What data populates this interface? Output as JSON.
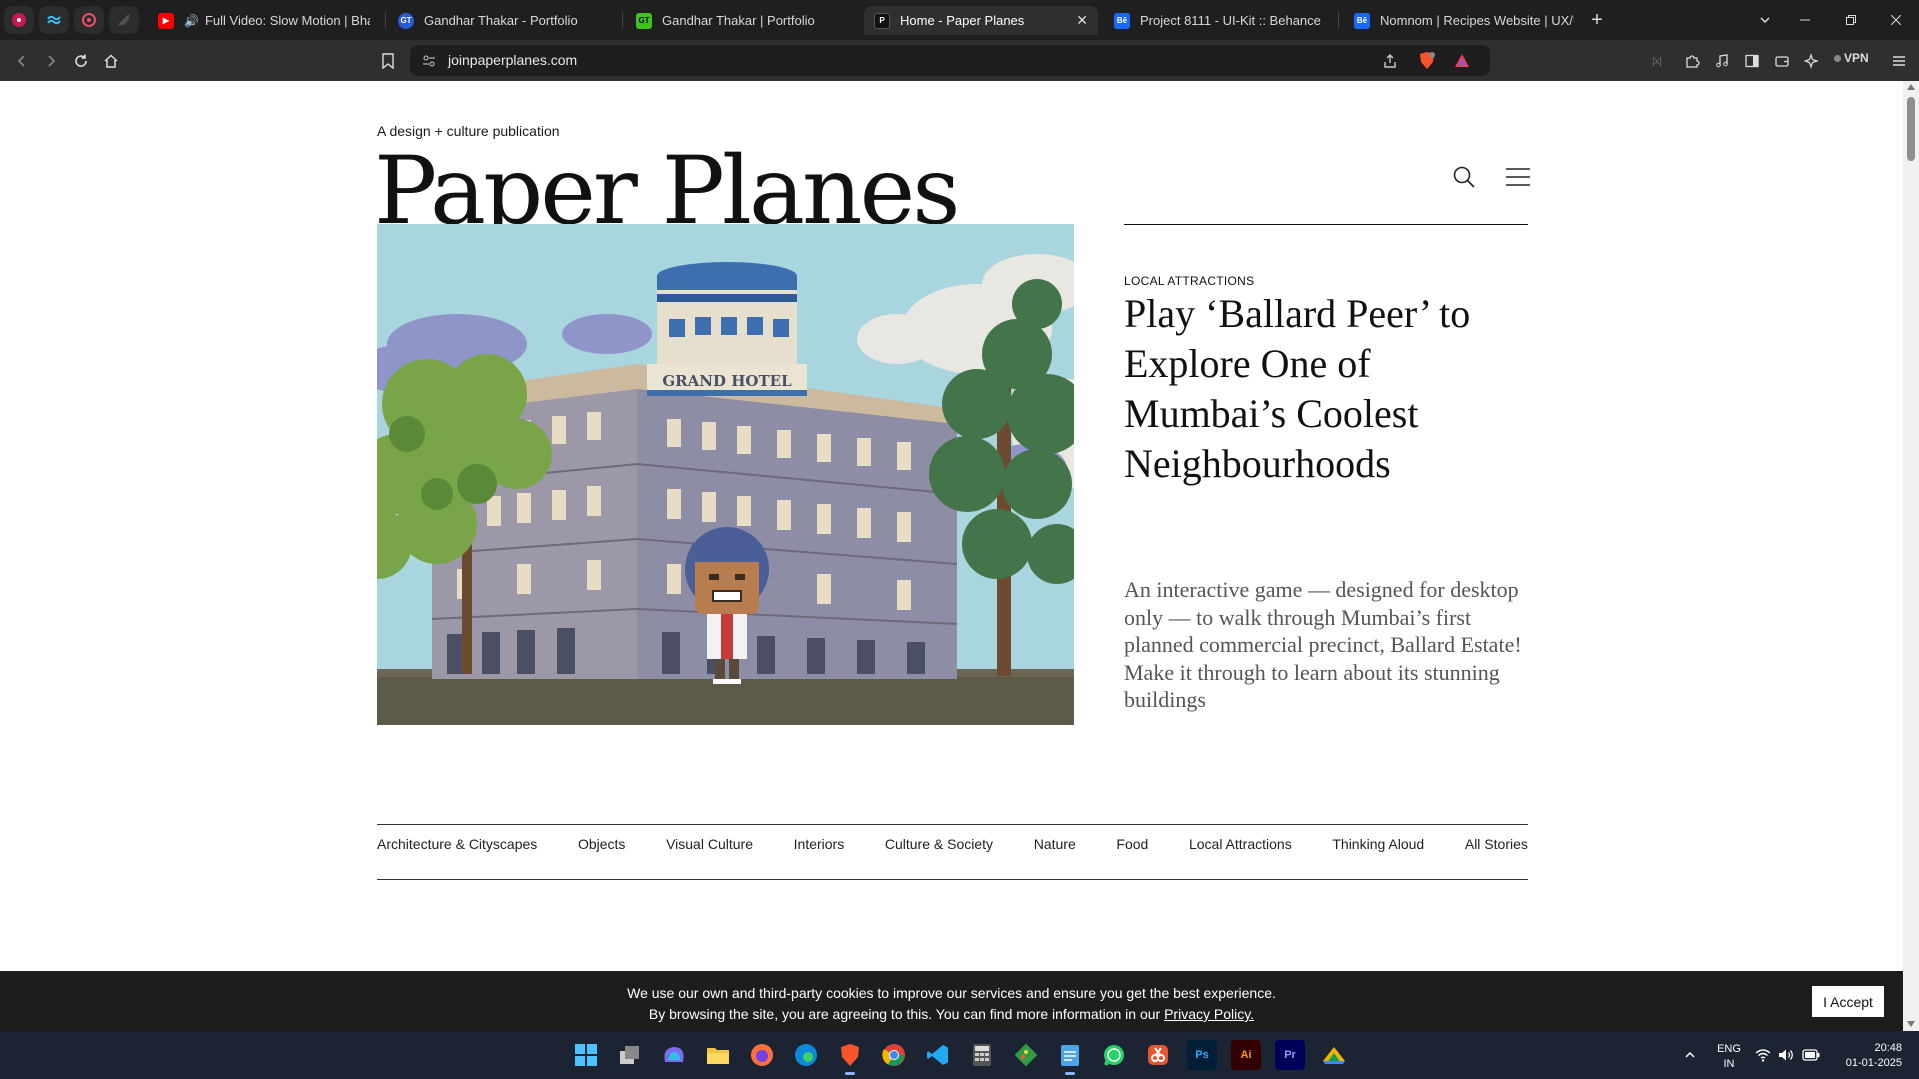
{
  "browser": {
    "tabs": [
      {
        "title": "Full Video: Slow Motion | Bharat",
        "active": false,
        "audio": true
      },
      {
        "title": "Gandhar Thakar - Portfolio",
        "active": false
      },
      {
        "title": "Gandhar Thakar | Portfolio",
        "active": false
      },
      {
        "title": "Home - Paper Planes",
        "active": true
      },
      {
        "title": "Project 8111 - UI-Kit :: Behance",
        "active": false
      },
      {
        "title": "Nomnom | Recipes Website | UX/UI",
        "active": false
      }
    ],
    "favicons": {
      "gt": "GT",
      "paper": "P",
      "behance": "Bē"
    },
    "url": "joinpaperplanes.com",
    "vpn_label": "VPN",
    "colors": {
      "tabstrip": "#1f1f1f",
      "toolbar": "#2f2f2f",
      "urlbar": "#1e1e1e"
    }
  },
  "site": {
    "tagline": "A design + culture publication",
    "logo": "Paper Planes",
    "hero_sign": "GRAND HOTEL",
    "featured": {
      "category": "LOCAL ATTRACTIONS",
      "headline": "Play ‘Ballard Peer’ to Explore One of Mumbai’s Coolest Neighbourhoods",
      "summary": "An interactive game — designed for desktop only — to walk through Mumbai’s first planned commercial precinct, Ballard Estate! Make it through to learn about its stunning buildings"
    },
    "categories": [
      "Architecture & Cityscapes",
      "Objects",
      "Visual Culture",
      "Interiors",
      "Culture & Society",
      "Nature",
      "Food",
      "Local Attractions",
      "Thinking Aloud",
      "All Stories"
    ]
  },
  "cookie": {
    "line1": "We use our own and third-party cookies to improve our services and ensure you get the best experience.",
    "line2_prefix": "By browsing the site, you are agreeing to this. You can find more information in our",
    "line2_link": "Privacy Policy.",
    "accept_label": "I Accept"
  },
  "taskbar": {
    "apps": [
      "start",
      "task-view",
      "copilot",
      "file-explorer",
      "firefox",
      "edge",
      "brave",
      "chrome",
      "vscode",
      "calculator",
      "git",
      "notepad",
      "whatsapp",
      "snipping-tool",
      "photoshop",
      "illustrator",
      "premiere-pro",
      "onedrive"
    ],
    "ps_label": "Ps",
    "ai_label": "Ai",
    "pr_label": "Pr",
    "lang_top": "ENG",
    "lang_bottom": "IN",
    "time": "20:48",
    "date": "01-01-2025"
  }
}
